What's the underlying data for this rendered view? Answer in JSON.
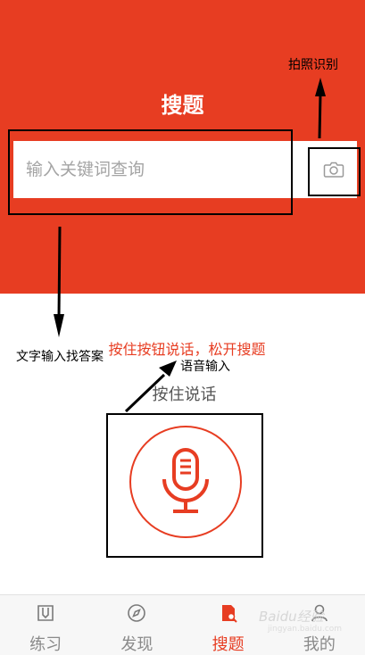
{
  "header": {
    "title": "搜题"
  },
  "search": {
    "placeholder": "输入关键词查询"
  },
  "annotations": {
    "photo": "拍照识别",
    "text_input": "文字输入找答案",
    "voice": "语音输入"
  },
  "voice": {
    "hint": "按住按钮说话，松开搜题",
    "press_label": "按住说话"
  },
  "tabs": [
    {
      "label": "练习",
      "icon": "pencil-book-icon"
    },
    {
      "label": "发现",
      "icon": "compass-icon"
    },
    {
      "label": "搜题",
      "icon": "search-doc-icon",
      "active": true
    },
    {
      "label": "我的",
      "icon": "user-icon"
    }
  ],
  "watermark": {
    "text": "Baidu经验",
    "sub": "jingyan.baidu.com"
  },
  "colors": {
    "accent": "#e73d22",
    "inactive": "#8a8a8a",
    "tabbar": "#f7f7f7"
  }
}
